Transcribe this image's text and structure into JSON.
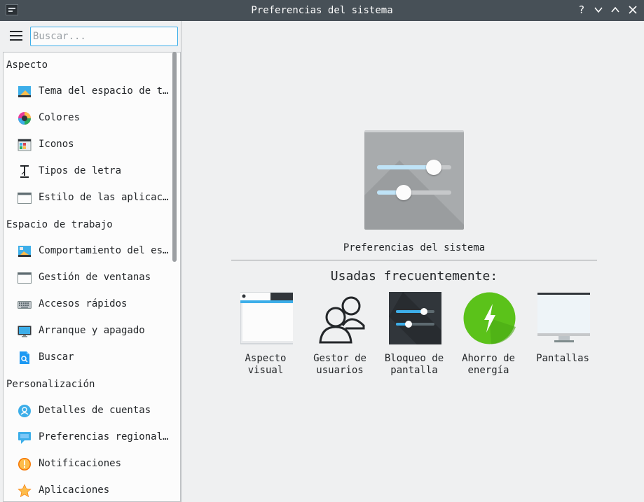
{
  "window": {
    "title": "Preferencias del sistema",
    "controls": [
      "?",
      "⌄",
      "⌃",
      "✕"
    ]
  },
  "sidebar": {
    "search_placeholder": "Buscar...",
    "sections": [
      {
        "title": "Aspecto",
        "items": [
          {
            "label": "Tema del espacio de tra…",
            "icon": "workspace-theme-icon"
          },
          {
            "label": "Colores",
            "icon": "color-wheel-icon"
          },
          {
            "label": "Iconos",
            "icon": "icons-icon"
          },
          {
            "label": "Tipos de letra",
            "icon": "font-icon"
          },
          {
            "label": "Estilo de las aplicacio…",
            "icon": "window-style-icon"
          }
        ]
      },
      {
        "title": "Espacio de trabajo",
        "items": [
          {
            "label": "Comportamiento del escr…",
            "icon": "desktop-behavior-icon"
          },
          {
            "label": "Gestión de ventanas",
            "icon": "window-management-icon"
          },
          {
            "label": "Accesos rápidos",
            "icon": "keyboard-icon"
          },
          {
            "label": "Arranque y apagado",
            "icon": "monitor-icon"
          },
          {
            "label": "Buscar",
            "icon": "search-file-icon"
          }
        ]
      },
      {
        "title": "Personalización",
        "items": [
          {
            "label": "Detalles de cuentas",
            "icon": "user-account-icon"
          },
          {
            "label": "Preferencias regionales",
            "icon": "regional-chat-icon"
          },
          {
            "label": "Notificaciones",
            "icon": "notification-icon"
          },
          {
            "label": "Aplicaciones",
            "icon": "star-icon"
          }
        ]
      }
    ]
  },
  "main": {
    "hero_caption": "Preferencias del sistema",
    "frequent_title": "Usadas frecuentemente:",
    "frequent": [
      {
        "label": "Aspecto\nvisual",
        "icon": "appearance-icon"
      },
      {
        "label": "Gestor de\nusuarios",
        "icon": "users-icon"
      },
      {
        "label": "Bloqueo de\npantalla",
        "icon": "screen-lock-icon"
      },
      {
        "label": "Ahorro de\nenergía",
        "icon": "energy-icon"
      },
      {
        "label": "Pantallas",
        "icon": "display-icon"
      }
    ]
  },
  "colors": {
    "titlebar": "#475057",
    "accent": "#3daee9",
    "energy_green": "#5bc21a",
    "window_bg": "#eff0f1",
    "list_bg": "#fcfcfc"
  }
}
